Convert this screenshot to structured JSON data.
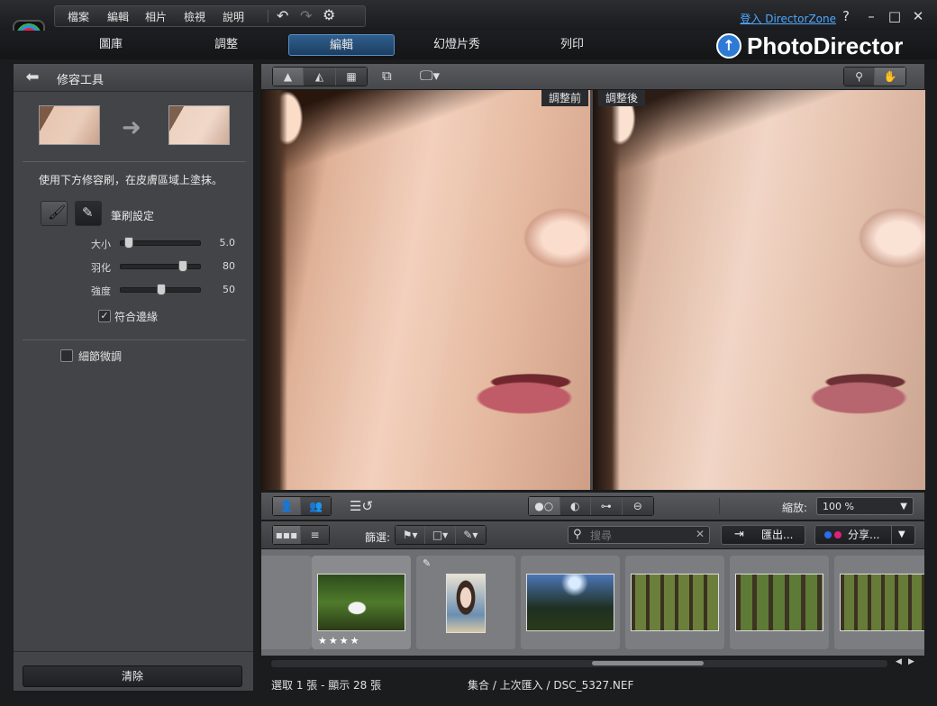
{
  "menu": {
    "items": [
      "檔案",
      "編輯",
      "相片",
      "檢視",
      "說明"
    ]
  },
  "top_right": {
    "login": "登入 DirectorZone"
  },
  "mode_tabs": [
    "圖庫",
    "調整",
    "編輯",
    "幻燈片秀",
    "列印"
  ],
  "active_tab": "編輯",
  "brand": {
    "name": "PhotoDirector"
  },
  "panel": {
    "title": "修容工具",
    "instruction": "使用下方修容刷，在皮膚區域上塗抹。",
    "brush_settings_label": "筆刷設定",
    "sliders": [
      {
        "label": "大小",
        "value": "5.0",
        "level": 0.05
      },
      {
        "label": "羽化",
        "value": "80",
        "level": 0.8
      },
      {
        "label": "強度",
        "value": "50",
        "level": 0.5
      }
    ],
    "fit_edges": {
      "label": "符合邊緣",
      "checked": true
    },
    "fine_tune": {
      "label": "細節微調",
      "checked": false
    },
    "clear_button": "清除"
  },
  "compare": {
    "before": "調整前",
    "after": "調整後"
  },
  "zoom": {
    "label": "縮放:",
    "value": "100 %"
  },
  "filter": {
    "label": "篩選:"
  },
  "search": {
    "placeholder": "搜尋"
  },
  "export_button": "匯出...",
  "share_button": "分享...",
  "filmstrip": {
    "rating_stars": 4
  },
  "status": {
    "selection": "選取 1 張 - 顯示 28 張",
    "path": "集合 / 上次匯入 / DSC_5327.NEF"
  },
  "colors": {
    "accent": "#2f5f8e",
    "link": "#4fa8ff",
    "share_blue": "#2c6cf0",
    "share_pink": "#e0207a"
  }
}
